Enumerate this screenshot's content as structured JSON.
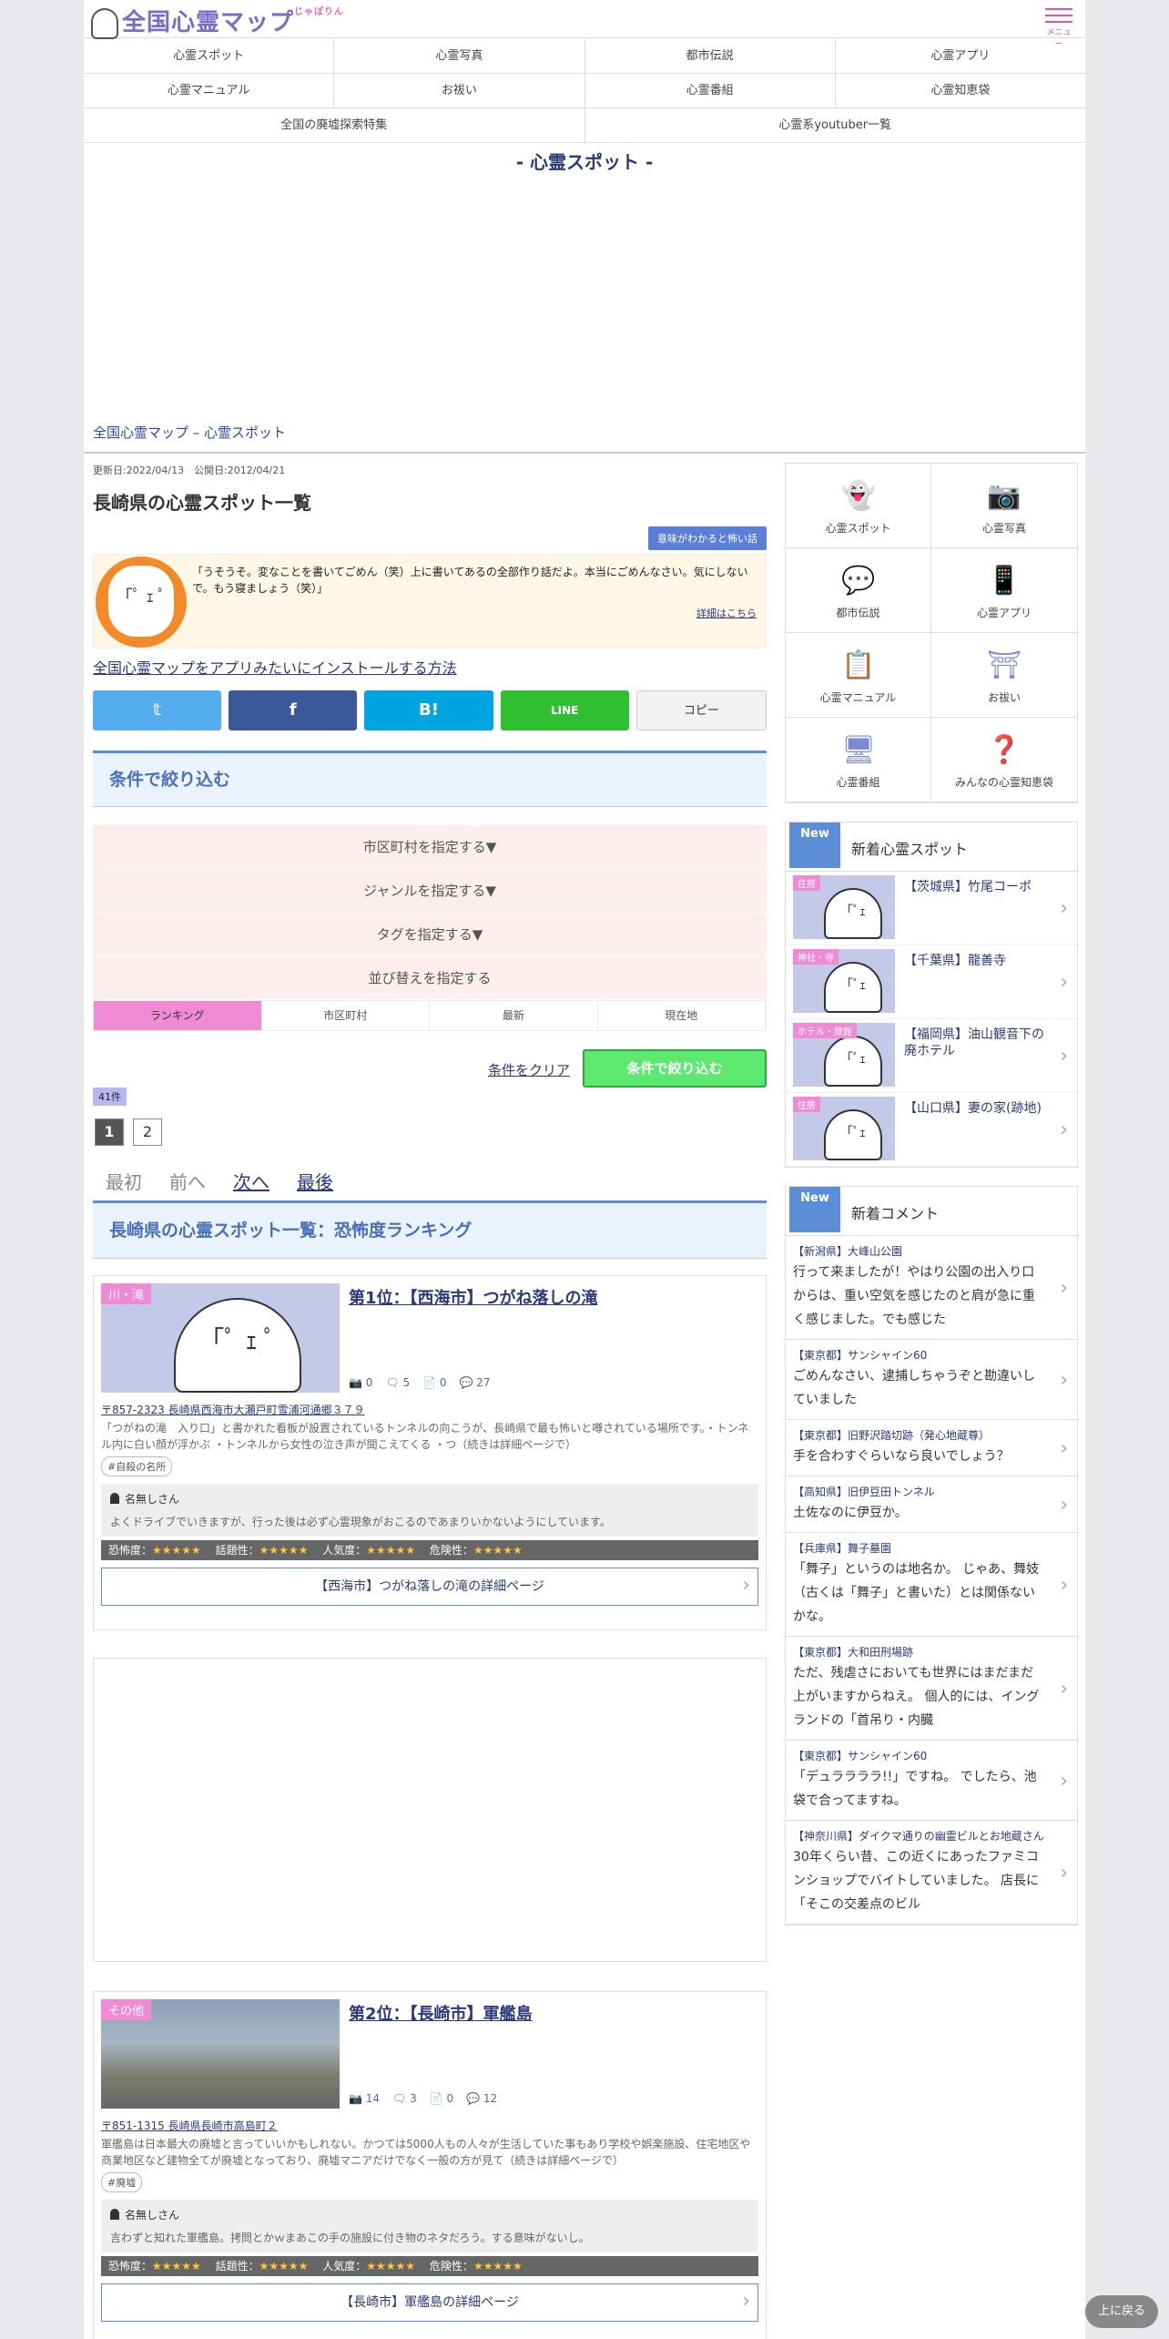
{
  "header": {
    "logo_text": "全国心霊マップ",
    "logo_ruby": "じゃぽりん",
    "menu_label": "メニュー"
  },
  "nav": {
    "row1": [
      "心霊スポット",
      "心霊写真",
      "都市伝説",
      "心霊アプリ"
    ],
    "row2": [
      "心霊マニュアル",
      "お祓い",
      "心霊番組",
      "心霊知恵袋"
    ],
    "row3": [
      "全国の廃墟探索特集",
      "心霊系youtuber一覧"
    ]
  },
  "section_title": "- 心霊スポット -",
  "breadcrumb": "全国心霊マップ – 心霊スポット",
  "page": {
    "dates": "更新日:2022/04/13　公開日:2012/04/21",
    "title": "長崎県の心霊スポット一覧",
    "tag_button": "意味がわかると怖い話",
    "chara_face": "「ﾟ ｪ ﾟ",
    "chara_text": "「うそうそ。変なことを書いてごめん（笑）上に書いてあるの全部作り話だよ。本当にごめんなさい。気にしないで。もう寝ましょう（笑）」",
    "chara_more": "詳細はこちら",
    "install_link": "全国心霊マップをアプリみたいにインストールする方法",
    "share": {
      "twitter": "𝕥",
      "facebook": "f",
      "hatena": "B!",
      "line": "LINE",
      "copy": "コピー"
    },
    "colors": {
      "twitter": "#55acee",
      "facebook": "#3b5998",
      "hatena": "#00a4de",
      "line": "#2fbf31"
    }
  },
  "filter": {
    "heading": "条件で絞り込む",
    "rows": [
      "市区町村を指定する▼",
      "ジャンルを指定する▼",
      "タグを指定する▼",
      "並び替えを指定する"
    ],
    "tabs": [
      "ランキング",
      "市区町村",
      "最新",
      "現在地"
    ],
    "clear": "条件をクリア",
    "apply": "条件で絞り込む",
    "count": "41件"
  },
  "pager": {
    "pages": [
      "1",
      "2"
    ],
    "first": "最初",
    "prev": "前へ",
    "next": "次へ",
    "last": "最後"
  },
  "list_heading": "長崎県の心霊スポット一覧：恐怖度ランキング",
  "items": [
    {
      "genre": "川・滝",
      "face": "「ﾟ ｪ ﾟ",
      "title": "第1位：【西海市】つがね落しの滝",
      "stats": {
        "photos": "0",
        "reports": "5",
        "posts": "0",
        "comments": "27"
      },
      "address": "〒857-2323 長崎県西海市大瀬戸町雪浦河通郷３７９",
      "desc": "「つがねの滝　入り口」と書かれた看板が設置されているトンネルの向こうが、長崎県で最も怖いと噂されている場所です。・トンネル内に白い顔が浮かぶ ・トンネルから女性の泣き声が聞こえてくる ・つ（続きは詳細ページで）",
      "tag": "#自殺の名所",
      "commenter": "名無しさん",
      "comment": "よくドライブでいきますが、行った後は必ず心霊現象がおこるのであまりいかないようにしています。",
      "ratings": {
        "fear_label": "恐怖度：",
        "fear": "★★★★★",
        "topic_label": "話題性：",
        "topic": "★★★★★",
        "pop_label": "人気度：",
        "pop": "★★★★★",
        "danger_label": "危険性：",
        "danger": "★★★★★"
      },
      "detail": "【西海市】つがね落しの滝の詳細ページ"
    },
    {
      "genre": "その他",
      "title": "第2位：【長崎市】軍艦島",
      "stats": {
        "photos": "14",
        "reports": "3",
        "posts": "0",
        "comments": "12"
      },
      "address": "〒851-1315 長崎県長崎市高島町２",
      "desc": "軍艦島は日本最大の廃墟と言っていいかもしれない。かつては5000人もの人々が生活していた事もあり学校や娯楽施設、住宅地区や商業地区など建物全てが廃墟となっており、廃墟マニアだけでなく一般の方が見て（続きは詳細ページで）",
      "tag": "#廃墟",
      "commenter": "名無しさん",
      "comment": "言わずと知れた軍艦島。拷問とかｗまあこの手の施設に付き物のネタだろう。する意味がないし。",
      "ratings": {
        "fear_label": "恐怖度：",
        "fear": "★★★★★",
        "topic_label": "話題性：",
        "topic": "★★★★★",
        "pop_label": "人気度：",
        "pop": "★★★★★",
        "danger_label": "危険性：",
        "danger": "★★★★★"
      },
      "detail": "【長崎市】軍艦島の詳細ページ"
    }
  ],
  "sidebar": {
    "categories": [
      {
        "label": "心霊スポット",
        "icon": "👻"
      },
      {
        "label": "心霊写真",
        "icon": "📷"
      },
      {
        "label": "都市伝説",
        "icon": "💬"
      },
      {
        "label": "心霊アプリ",
        "icon": "📱"
      },
      {
        "label": "心霊マニュアル",
        "icon": "📋"
      },
      {
        "label": "お祓い",
        "icon": "⛩"
      },
      {
        "label": "心霊番組",
        "icon": "🖥"
      },
      {
        "label": "みんなの心霊知恵袋",
        "icon": "❓"
      }
    ],
    "new_label": "New",
    "new_spots_title": "新着心霊スポット",
    "new_spots": [
      {
        "genre": "住居",
        "name": "【茨城県】竹尾コーポ"
      },
      {
        "genre": "神社・寺",
        "name": "【千葉県】龍善寺"
      },
      {
        "genre": "ホテル・旅館",
        "name": "【福岡県】油山観音下の廃ホテル"
      },
      {
        "genre": "住居",
        "name": "【山口県】妻の家(跡地)"
      }
    ],
    "spot_face": "「ﾟｪ",
    "new_comments_title": "新着コメント",
    "new_comments": [
      {
        "place": "【新潟県】大峰山公園",
        "text": "行って来ましたが！やはり公園の出入り口からは、重い空気を感じたのと肩が急に重く感じました。でも感じた"
      },
      {
        "place": "【東京都】サンシャイン60",
        "text": "ごめんなさい、逮捕しちゃうぞと勘違いしていました"
      },
      {
        "place": "【東京都】旧野沢踏切跡（発心地蔵尊）",
        "text": "手を合わすぐらいなら良いでしょう？"
      },
      {
        "place": "【高知県】旧伊豆田トンネル",
        "text": "土佐なのに伊豆か。"
      },
      {
        "place": "【兵庫県】舞子墓園",
        "text": "「舞子」というのは地名か。 じゃあ、舞妓（古くは「舞子」と書いた）とは関係ないかな。"
      },
      {
        "place": "【東京都】大和田刑場跡",
        "text": "ただ、残虐さにおいても世界にはまだまだ上がいますからねえ。 個人的には、イングランドの「首吊り・内臓"
      },
      {
        "place": "【東京都】サンシャイン60",
        "text": "「デュララララ!!」ですね。 でしたら、池袋で合ってますね。"
      },
      {
        "place": "【神奈川県】ダイクマ通りの幽霊ビルとお地蔵さん",
        "text": "30年くらい昔、この近くにあったファミコンショップでバイトしていました。 店長に「そこの交差点のビル"
      }
    ]
  },
  "to_top": "上に戻る"
}
